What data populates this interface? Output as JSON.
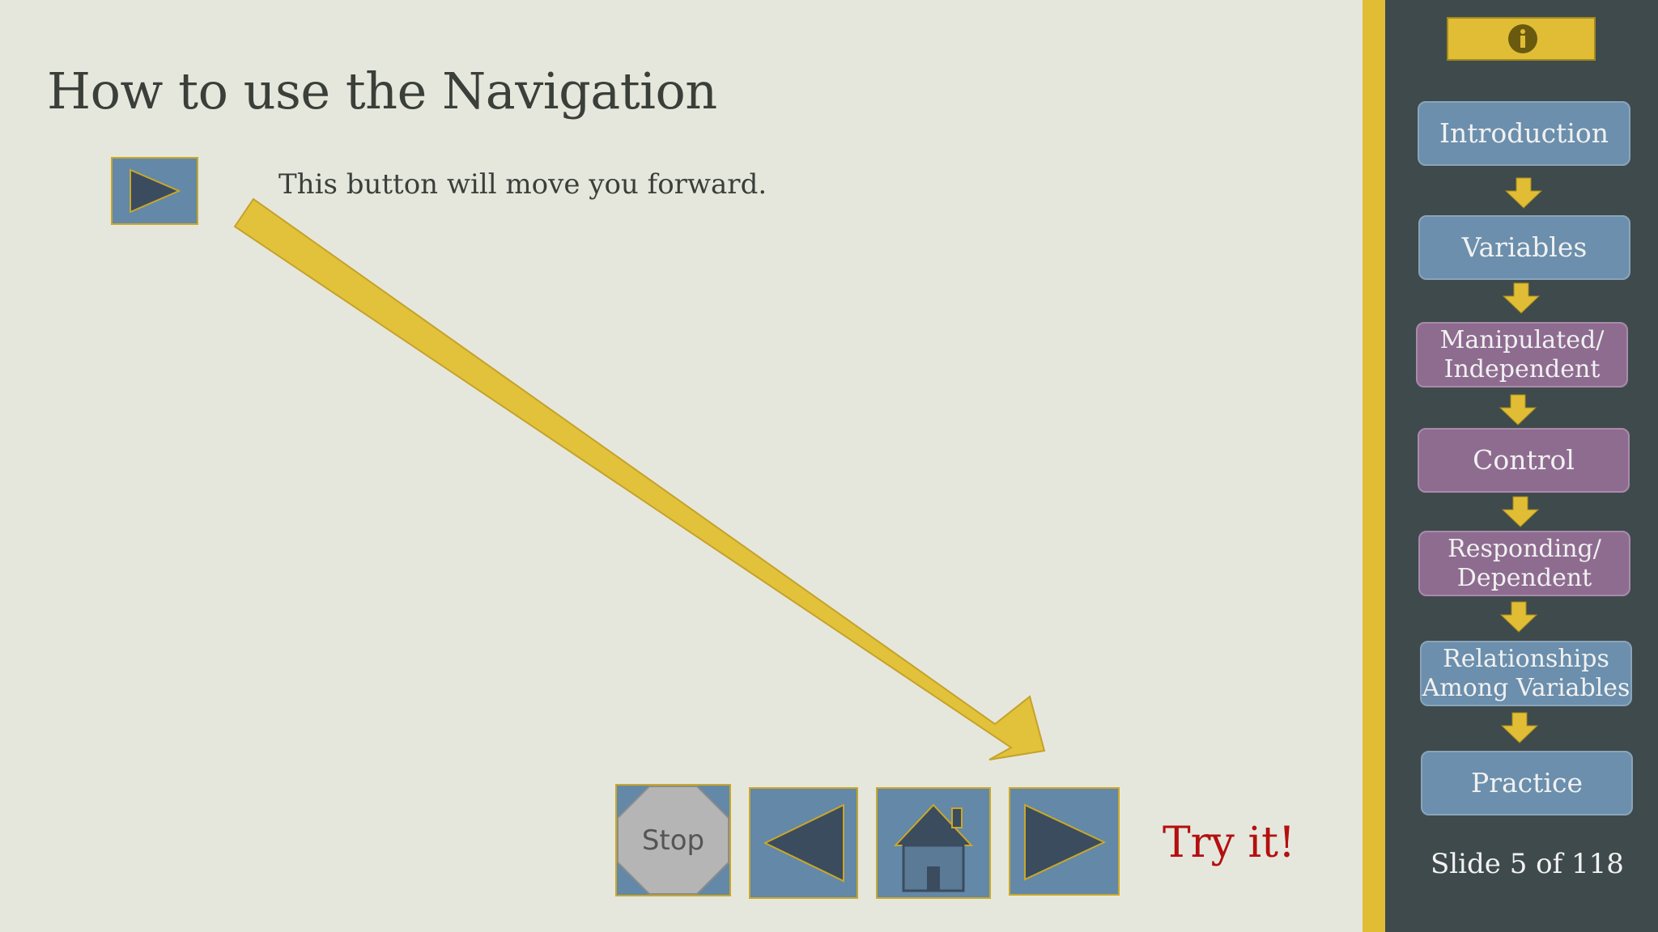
{
  "slide": {
    "title": "How to use the Navigation",
    "caption": "This button will move you forward.",
    "try_it": "Try it!"
  },
  "nav": {
    "stop_label": "Stop",
    "icons": [
      "stop-icon",
      "back-arrow-icon",
      "home-icon",
      "forward-arrow-icon"
    ]
  },
  "sidebar": {
    "info_icon": "info-icon",
    "items": [
      {
        "label": "Introduction",
        "color": "blue"
      },
      {
        "label": "Variables",
        "color": "blue"
      },
      {
        "label": "Manipulated/\nIndependent",
        "color": "purple"
      },
      {
        "label": "Control",
        "color": "purple"
      },
      {
        "label": "Responding/\nDependent",
        "color": "purple"
      },
      {
        "label": "Relationships\nAmong Variables",
        "color": "blue"
      },
      {
        "label": "Practice",
        "color": "blue"
      }
    ],
    "slide_counter": "Slide 5 of 118"
  },
  "colors": {
    "background": "#e6e7dc",
    "button_blue": "#6388a8",
    "accent_yellow": "#e1bd35",
    "try_it_red": "#b31010",
    "sidebar_dark": "#3f4a4c",
    "menu_purple": "#8e6c90"
  }
}
